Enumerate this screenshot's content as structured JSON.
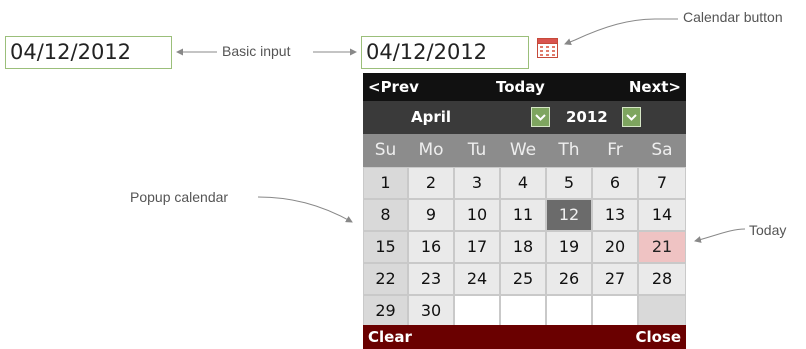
{
  "basic_input": {
    "value": "04/12/2012"
  },
  "picker_input": {
    "value": "04/12/2012"
  },
  "annotations": {
    "basic_input": "Basic input",
    "calendar_button": "Calendar button",
    "popup_calendar": "Popup calendar",
    "today": "Today"
  },
  "calendar": {
    "nav": {
      "prev": "<Prev",
      "today": "Today",
      "next": "Next>"
    },
    "month": "April",
    "year": "2012",
    "weekdays": [
      "Su",
      "Mo",
      "Tu",
      "We",
      "Th",
      "Fr",
      "Sa"
    ],
    "weeks": [
      [
        "1",
        "2",
        "3",
        "4",
        "5",
        "6",
        "7"
      ],
      [
        "8",
        "9",
        "10",
        "11",
        "12",
        "13",
        "14"
      ],
      [
        "15",
        "16",
        "17",
        "18",
        "19",
        "20",
        "21"
      ],
      [
        "22",
        "23",
        "24",
        "25",
        "26",
        "27",
        "28"
      ],
      [
        "29",
        "30",
        "",
        "",
        "",
        "",
        ""
      ]
    ],
    "today_date": "12",
    "highlighted_date": "21",
    "footer": {
      "clear": "Clear",
      "close": "Close"
    }
  },
  "colors": {
    "input_border": "#9bbf7a",
    "nav_bar": "#111111",
    "select_bar": "#3a3a3a",
    "weekday_row": "#8c8c8c",
    "day_cell": "#eaeaea",
    "sunday_cell": "#d9d9d9",
    "today_cell": "#6b6b6b",
    "highlighted_cell": "#efc3c3",
    "footer_bar": "#6a0000",
    "dropdown": "#7ea55f"
  },
  "icons": {
    "calendar_button": "calendar-icon",
    "dropdown": "chevron-down-icon"
  }
}
